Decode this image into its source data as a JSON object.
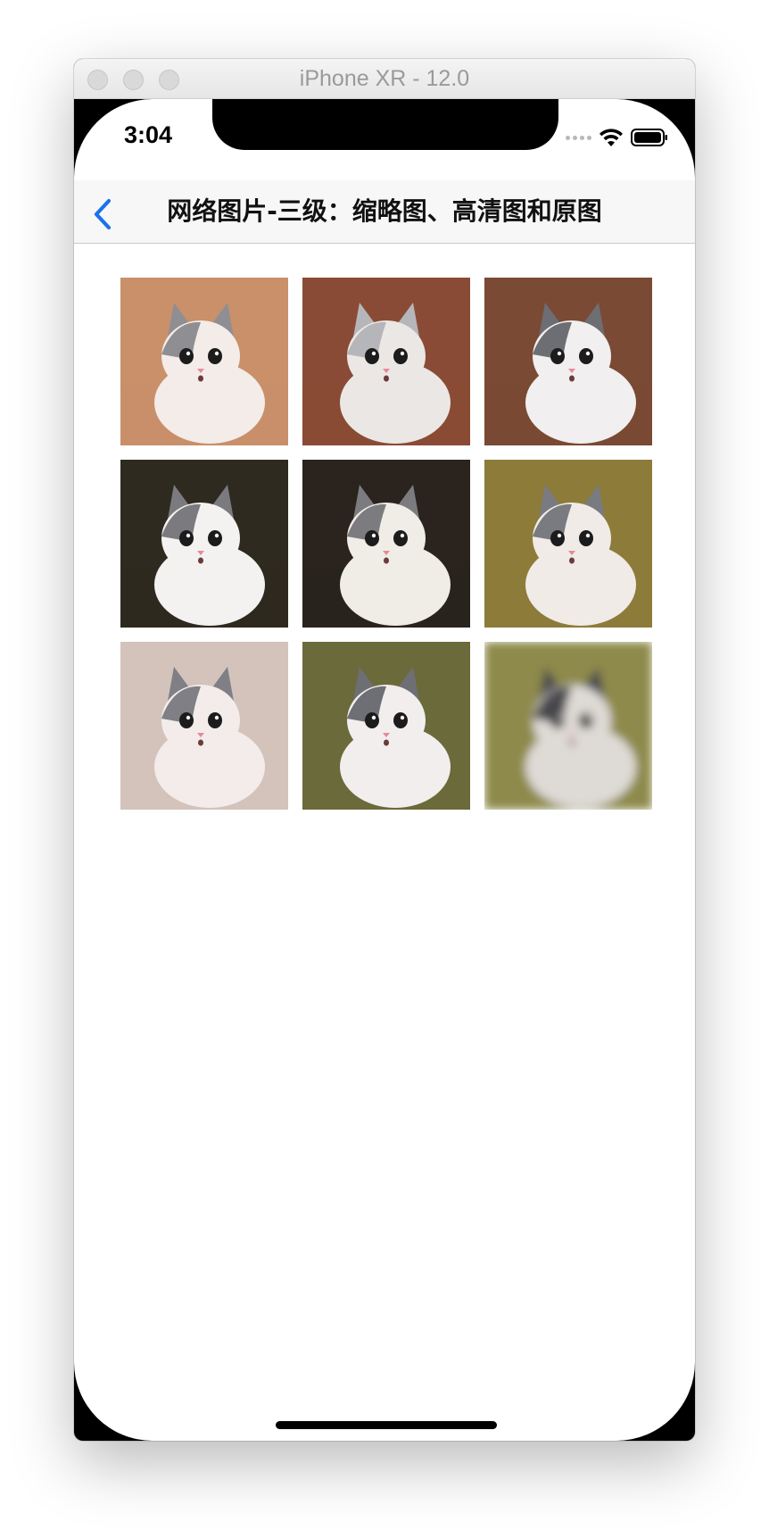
{
  "window": {
    "title": "iPhone XR - 12.0"
  },
  "status_bar": {
    "time": "3:04",
    "icons": [
      "signal-dots-icon",
      "wifi-icon",
      "battery-icon"
    ]
  },
  "nav_bar": {
    "back_icon": "chevron-left-icon",
    "title": "网络图片-三级：缩略图、高清图和原图",
    "accent_color": "#1a73e8"
  },
  "gallery": {
    "image_count": 9,
    "images": [
      {
        "subject": "kitten",
        "bg": "#c9906a",
        "body": "#f3ece8",
        "patch": "#8f8f93"
      },
      {
        "subject": "kitten",
        "bg": "#8a4b36",
        "body": "#ebe7e4",
        "patch": "#b6b6ba"
      },
      {
        "subject": "kitten",
        "bg": "#7a4a34",
        "body": "#f1efef",
        "patch": "#6d6e73"
      },
      {
        "subject": "kitten",
        "bg": "#2e2a1f",
        "body": "#f4f2f0",
        "patch": "#7b7b7f"
      },
      {
        "subject": "kitten",
        "bg": "#2a231e",
        "body": "#f0ece6",
        "patch": "#7c7c80"
      },
      {
        "subject": "kitten",
        "bg": "#8d7b3a",
        "body": "#f0ebe6",
        "patch": "#7a7b80"
      },
      {
        "subject": "kitten",
        "bg": "#d3c3bb",
        "body": "#f3ecea",
        "patch": "#7f7f85"
      },
      {
        "subject": "kitten",
        "bg": "#6b6a3a",
        "body": "#f2eeee",
        "patch": "#6e6f74"
      },
      {
        "subject": "kitten-blurred",
        "bg": "#8e8a4c",
        "body": "#dedad6",
        "patch": "#4a4a4e"
      }
    ]
  },
  "colors": {
    "window_frame": "#000000",
    "titlebar_text": "#9a9a9a",
    "screen_bg": "#ffffff",
    "navbar_bg": "#f7f7f7"
  }
}
